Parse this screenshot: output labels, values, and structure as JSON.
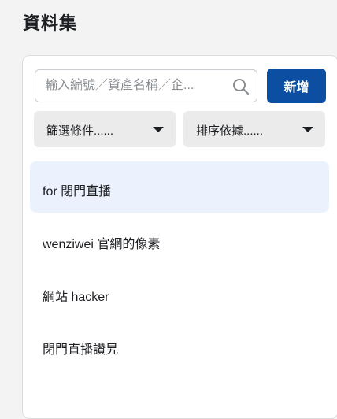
{
  "page": {
    "title": "資料集"
  },
  "search": {
    "placeholder": "輸入編號／資產名稱／企..."
  },
  "toolbar": {
    "add_label": "新增"
  },
  "filters": {
    "filter_label": "篩選條件......",
    "sort_label": "排序依據......"
  },
  "datasets": {
    "items": [
      {
        "label": "for 閉門直播",
        "selected": true
      },
      {
        "label": "wenziwei 官網的像素",
        "selected": false
      },
      {
        "label": "網站 hacker",
        "selected": false
      },
      {
        "label": "閉門直播讚旯",
        "selected": false
      }
    ]
  },
  "colors": {
    "accent": "#0b4ea2",
    "selected_bg": "#ebf2fd",
    "page_bg": "#f3f3f3"
  }
}
